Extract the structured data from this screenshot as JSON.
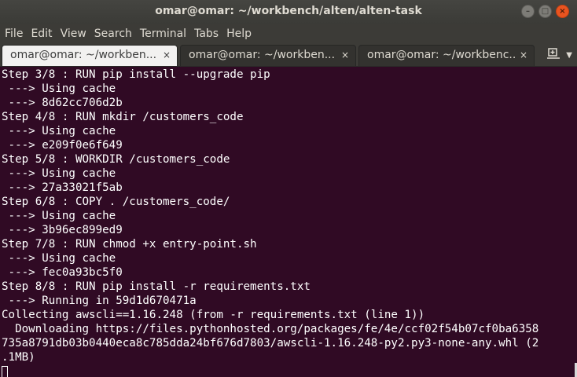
{
  "window": {
    "title": "omar@omar: ~/workbench/alten/alten-task"
  },
  "menu": [
    "File",
    "Edit",
    "View",
    "Search",
    "Terminal",
    "Tabs",
    "Help"
  ],
  "tabs": [
    {
      "label": "omar@omar: ~/workben...",
      "close": "×",
      "active": true
    },
    {
      "label": "omar@omar: ~/workben...",
      "close": "×",
      "active": false
    },
    {
      "label": "omar@omar: ~/workbenc...",
      "close": "×",
      "active": false
    }
  ],
  "terminal": {
    "lines": [
      "Step 3/8 : RUN pip install --upgrade pip",
      " ---> Using cache",
      " ---> 8d62cc706d2b",
      "Step 4/8 : RUN mkdir /customers_code",
      " ---> Using cache",
      " ---> e209f0e6f649",
      "Step 5/8 : WORKDIR /customers_code",
      " ---> Using cache",
      " ---> 27a33021f5ab",
      "Step 6/8 : COPY . /customers_code/",
      " ---> Using cache",
      " ---> 3b96ec899ed9",
      "Step 7/8 : RUN chmod +x entry-point.sh",
      " ---> Using cache",
      " ---> fec0a93bc5f0",
      "Step 8/8 : RUN pip install -r requirements.txt",
      " ---> Running in 59d1d670471a",
      "Collecting awscli==1.16.248 (from -r requirements.txt (line 1))",
      "  Downloading https://files.pythonhosted.org/packages/fe/4e/ccf02f54b07cf0ba6358",
      "735a8791db03b0440eca8c785dda24bf676d7803/awscli-1.16.248-py2.py3-none-any.whl (2",
      ".1MB)"
    ]
  }
}
